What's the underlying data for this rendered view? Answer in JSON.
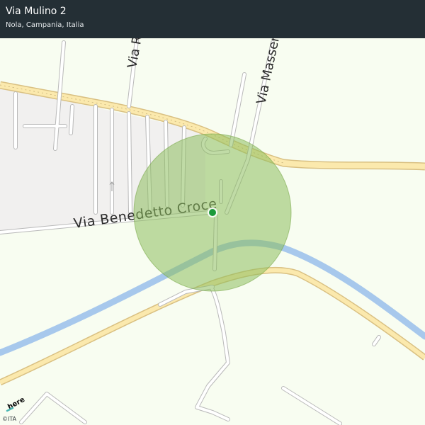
{
  "header": {
    "title": "Via Mulino 2",
    "subtitle": "Nola, Campania, Italia"
  },
  "map": {
    "street_labels": {
      "benedetto_croce": "Via Benedetto Croce",
      "ricciol": "Via Riccio",
      "masseria": "Via Masseria P"
    },
    "marker_icon": "location-pin-icon",
    "accuracy_color": "#8dbd5c",
    "marker_color": "#1b9a3a",
    "road_major_color": "#fbe8a8",
    "road_major_outline": "#e2c98a",
    "river_color": "#a9c9ec",
    "background_color": "#f8fdf1",
    "builtup_color": "#f3f2f1"
  },
  "branding": {
    "logo_text": "here",
    "copyright": "©ITA"
  }
}
